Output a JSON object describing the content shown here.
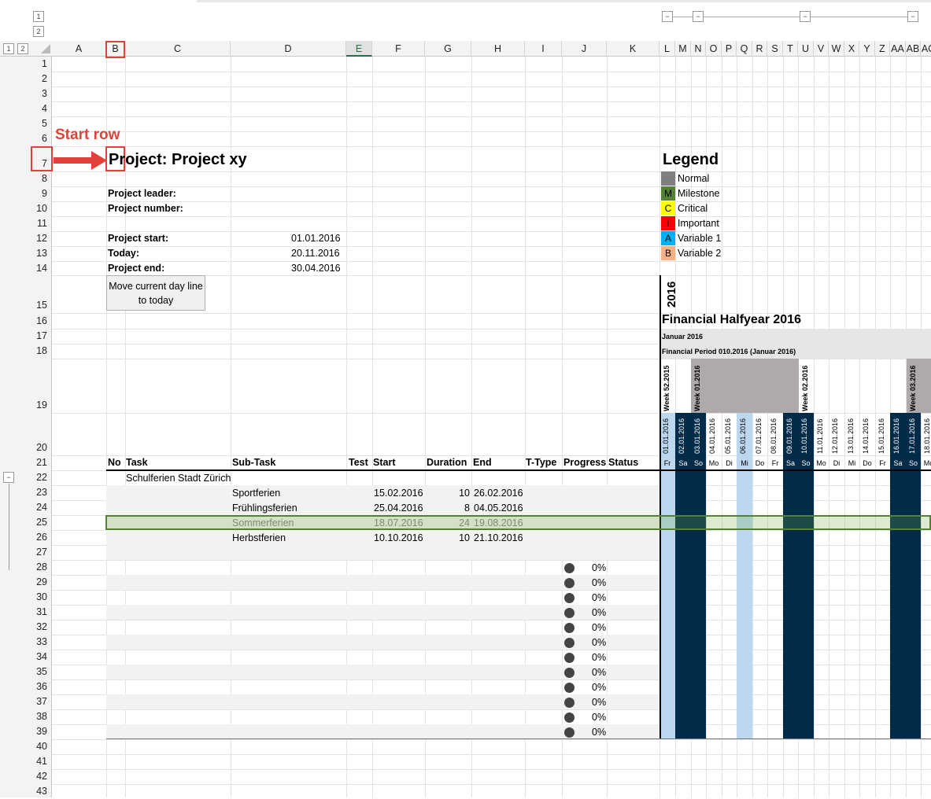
{
  "outline": {
    "row_levels": [
      "1",
      "2"
    ],
    "col_levels": [
      "1",
      "2"
    ],
    "collapse": "−"
  },
  "columns": [
    "A",
    "B",
    "C",
    "D",
    "E",
    "F",
    "G",
    "H",
    "I",
    "J",
    "K",
    "L",
    "M",
    "N",
    "O",
    "P",
    "Q",
    "R",
    "S",
    "T",
    "U",
    "V",
    "W",
    "X",
    "Y",
    "Z",
    "AA",
    "AB",
    "AC"
  ],
  "rows": [
    "1",
    "2",
    "3",
    "4",
    "5",
    "6",
    "7",
    "8",
    "9",
    "10",
    "11",
    "12",
    "13",
    "14",
    "15",
    "16",
    "17",
    "18",
    "19",
    "20",
    "21",
    "22",
    "23",
    "24",
    "25",
    "26",
    "27",
    "28",
    "29",
    "30",
    "31",
    "32",
    "33",
    "34",
    "35",
    "36",
    "37",
    "38",
    "39",
    "40",
    "41",
    "42",
    "43"
  ],
  "annotation": {
    "label": "Start row"
  },
  "project": {
    "title": "Project: Project xy",
    "leader_label": "Project leader:",
    "number_label": "Project number:",
    "start_label": "Project start:",
    "start_value": "01.01.2016",
    "today_label": "Today:",
    "today_value": "20.11.2016",
    "end_label": "Project end:",
    "end_value": "30.04.2016",
    "button": "Move current day line to today"
  },
  "legend": {
    "title": "Legend",
    "items": [
      {
        "code": "",
        "label": "Normal",
        "color": "#7f7f7f"
      },
      {
        "code": "M",
        "label": "Milestone",
        "color": "#548235"
      },
      {
        "code": "C",
        "label": "Critical",
        "color": "#ffff00"
      },
      {
        "code": "I",
        "label": "Important",
        "color": "#ff0000"
      },
      {
        "code": "A",
        "label": "Variable 1",
        "color": "#00b0f0"
      },
      {
        "code": "B",
        "label": "Variable 2",
        "color": "#f4b183"
      }
    ]
  },
  "timeline": {
    "year": "2016",
    "halfyear": "Financial Halfyear 2016",
    "month": "Januar 2016",
    "period": "Financial Period 010.2016 (Januar 2016)",
    "weeks": [
      "Week 52.2015",
      "Week 01.2016",
      "Week 02.2016",
      "Week 03.2016"
    ],
    "dates": [
      "01.01.2016",
      "02.01.2016",
      "03.01.2016",
      "04.01.2016",
      "05.01.2016",
      "06.01.2016",
      "07.01.2016",
      "08.01.2016",
      "09.01.2016",
      "10.01.2016",
      "11.01.2016",
      "12.01.2016",
      "13.01.2016",
      "14.01.2016",
      "15.01.2016",
      "16.01.2016",
      "17.01.2016",
      "18.01.2016"
    ],
    "days": [
      "Fr",
      "Sa",
      "So",
      "Mo",
      "Di",
      "Mi",
      "Do",
      "Fr",
      "Sa",
      "So",
      "Mo",
      "Di",
      "Mi",
      "Do",
      "Fr",
      "Sa",
      "So",
      "Mo"
    ],
    "weekend_color": "#002b49",
    "highlight_color": "#bdd7ee"
  },
  "table": {
    "headers": {
      "no": "No",
      "task": "Task",
      "subtask": "Sub-Task",
      "test": "Test",
      "start": "Start",
      "duration": "Duration",
      "end": "End",
      "ttype": "T-Type",
      "progress": "Progress",
      "status": "Status"
    },
    "group": "Schulferien Stadt Zürich",
    "tasks": [
      {
        "subtask": "Sportferien",
        "start": "15.02.2016",
        "duration": "10",
        "end": "26.02.2016"
      },
      {
        "subtask": "Frühlingsferien",
        "start": "25.04.2016",
        "duration": "8",
        "end": "04.05.2016"
      },
      {
        "subtask": "Sommerferien",
        "start": "18.07.2016",
        "duration": "24",
        "end": "19.08.2016"
      },
      {
        "subtask": "Herbstferien",
        "start": "10.10.2016",
        "duration": "10",
        "end": "21.10.2016"
      }
    ],
    "progress": [
      "0%",
      "0%",
      "0%",
      "0%",
      "0%",
      "0%",
      "0%",
      "0%",
      "0%",
      "0%",
      "0%",
      "0%"
    ]
  }
}
